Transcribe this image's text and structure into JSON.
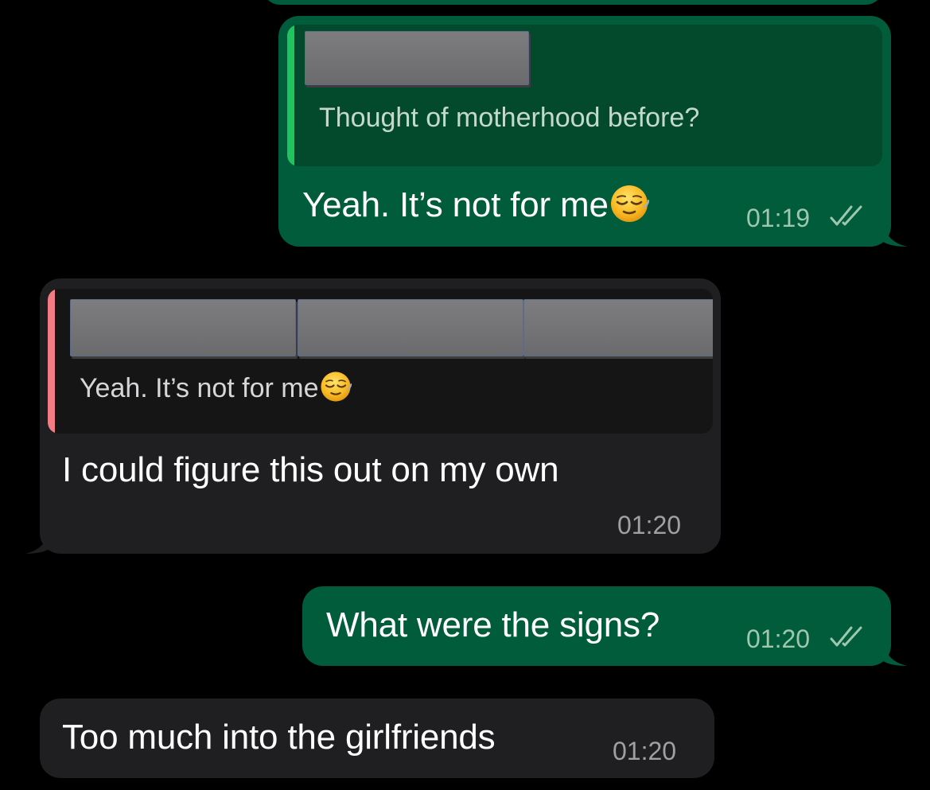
{
  "messages": [
    {
      "direction": "outgoing",
      "quote": {
        "text": "Thought of motherhood before?"
      },
      "text": "Yeah. It’s not for me",
      "emoji": "relieved-face-emoji",
      "time": "01:19",
      "status": "read"
    },
    {
      "direction": "incoming",
      "quote": {
        "text": "Yeah. It’s not for me",
        "emoji": "relieved-face-emoji"
      },
      "text": "I could figure this out on my own",
      "time": "01:20"
    },
    {
      "direction": "outgoing",
      "text": "What were the signs?",
      "time": "01:20",
      "status": "read"
    },
    {
      "direction": "incoming",
      "text": "Too much into the girlfriends",
      "time": "01:20"
    }
  ],
  "colors": {
    "background": "#000000",
    "outgoing_bubble": "#005c3a",
    "incoming_bubble": "#1f1f21",
    "outgoing_quote_bar": "#21c45c",
    "incoming_quote_bar": "#f37b86"
  }
}
